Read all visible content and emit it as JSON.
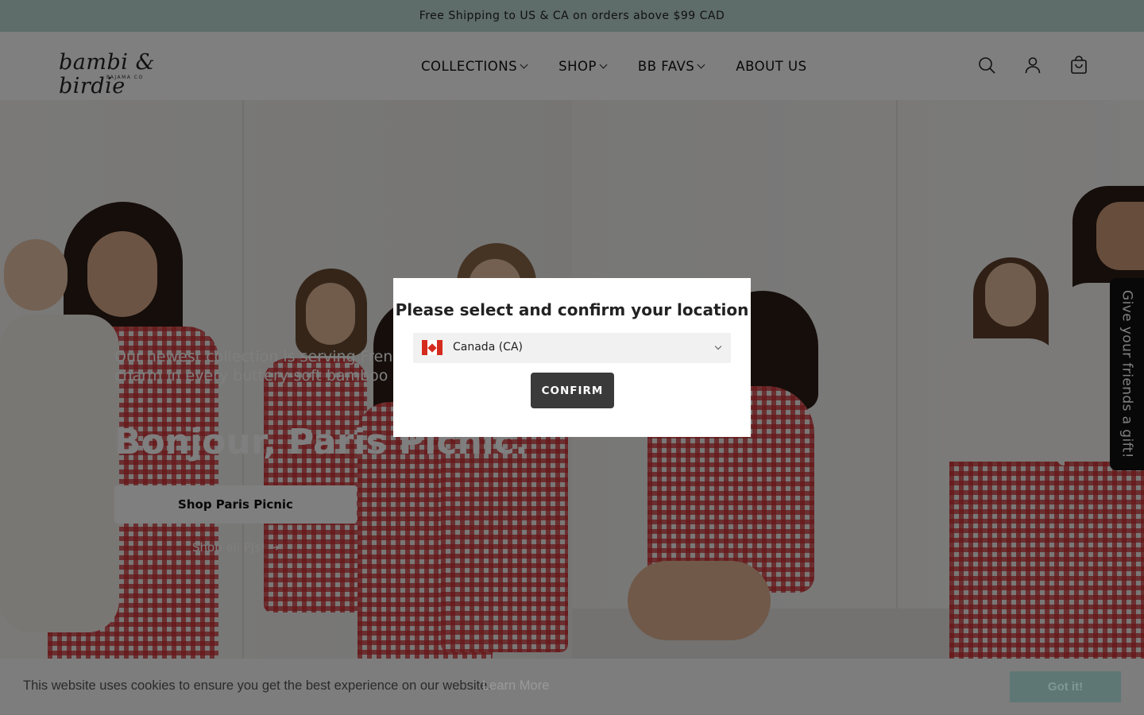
{
  "announcement": {
    "text": "Free Shipping to US & CA on orders above $99 CAD"
  },
  "header": {
    "logo_text": "bambi & birdie",
    "logo_sub": "PAJAMA CO",
    "nav": [
      {
        "label": "COLLECTIONS",
        "has_dropdown": true
      },
      {
        "label": "SHOP",
        "has_dropdown": true
      },
      {
        "label": "BB FAVS",
        "has_dropdown": true
      },
      {
        "label": "ABOUT US",
        "has_dropdown": false
      }
    ],
    "icons": [
      "search-icon",
      "account-icon",
      "cart-icon"
    ]
  },
  "hero": {
    "subtitle": "Our newest collection is serving French charm in every buttery-soft bamboo style.",
    "title": "Bonjour, Paris Picnic.",
    "cta_label": "Shop Paris Picnic",
    "secondary_link": "Shop all PJs! →"
  },
  "gift_tab": {
    "label": "Give your friends a gift!"
  },
  "location_modal": {
    "title": "Please select and confirm your location",
    "selected_location": "Canada (CA)",
    "flag_icon": "canada-flag-icon",
    "confirm_label": "CONFIRM"
  },
  "cookie_banner": {
    "message": "This website uses cookies to ensure you get the best experience on our website.",
    "learn_more": "Learn More",
    "accept_label": "Got it!"
  },
  "colors": {
    "announcement_bg": "#bcd9d5",
    "confirm_bg": "#3a3a3a",
    "cookie_bg": "#7d7d7d",
    "cookie_button_bg": "#5e7775"
  }
}
